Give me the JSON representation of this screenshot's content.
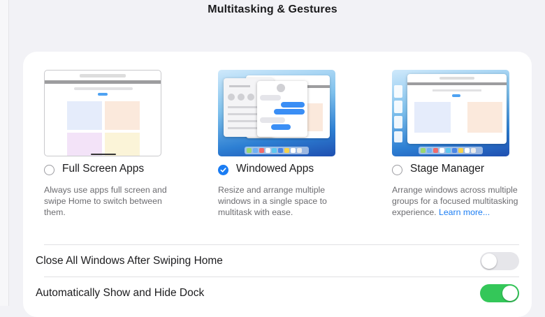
{
  "header": {
    "title": "Multitasking & Gestures"
  },
  "options": [
    {
      "label": "Full Screen Apps",
      "selected": false,
      "description": "Always use apps full screen and swipe Home to switch between them."
    },
    {
      "label": "Windowed Apps",
      "selected": true,
      "description": "Resize and arrange multiple windows in a single space to multitask with ease."
    },
    {
      "label": "Stage Manager",
      "selected": false,
      "description": "Arrange windows across multiple groups for a focused multitasking experience.",
      "link": "Learn more..."
    }
  ],
  "toggles": [
    {
      "label": "Close All Windows After Swiping Home",
      "on": false
    },
    {
      "label": "Automatically Show and Hide Dock",
      "on": true
    }
  ],
  "colors": {
    "accent": "#1a7cf3",
    "switch_on": "#34c759",
    "switch_off": "#e6e6ea"
  }
}
